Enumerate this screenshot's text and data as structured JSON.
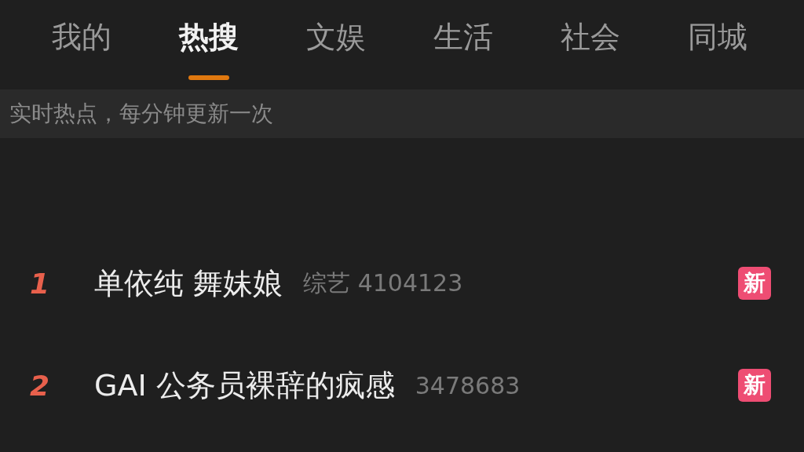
{
  "tabs": [
    {
      "label": "我的",
      "selected": false
    },
    {
      "label": "热搜",
      "selected": true
    },
    {
      "label": "文娱",
      "selected": false
    },
    {
      "label": "生活",
      "selected": false
    },
    {
      "label": "社会",
      "selected": false
    },
    {
      "label": "同城",
      "selected": false
    }
  ],
  "notice": "实时热点，每分钟更新一次",
  "rows": [
    {
      "rank": "1",
      "title": "单依纯 舞妹娘",
      "category": "综艺",
      "count": "4104123",
      "badge": "新"
    },
    {
      "rank": "2",
      "title": "GAI 公务员裸辞的疯感",
      "count": "3478683",
      "badge": "新"
    }
  ]
}
